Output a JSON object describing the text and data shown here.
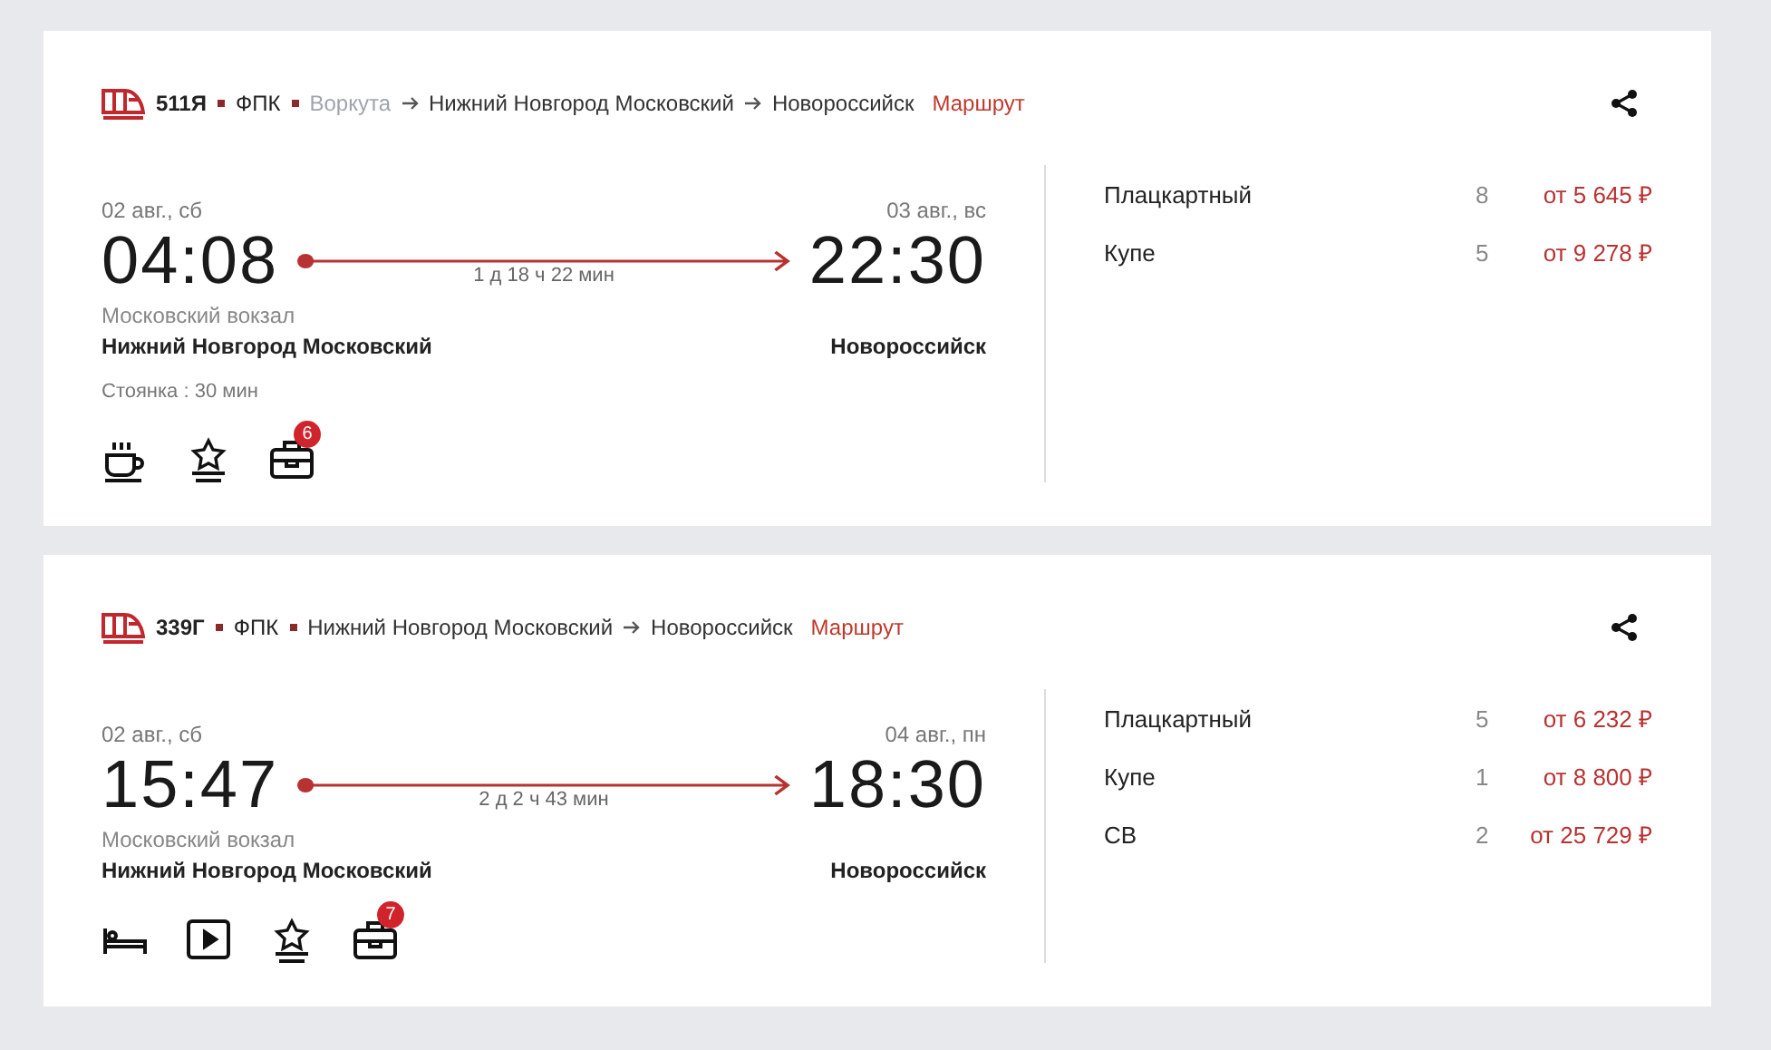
{
  "trains": [
    {
      "number": "511Я",
      "carrier": "ФПК",
      "route": [
        {
          "name": "Воркута",
          "dimmed": true
        },
        {
          "name": "Нижний Новгород Московский",
          "dimmed": false
        },
        {
          "name": "Новороссийск",
          "dimmed": false
        }
      ],
      "route_link": "Маршрут",
      "depart": {
        "date": "02 авг., сб",
        "time": "04:08",
        "station": "Московский вокзал",
        "city": "Нижний Новгород Московский"
      },
      "duration": "1 д 18 ч 22 мин",
      "arrive": {
        "date": "03 авг., вс",
        "time": "22:30",
        "city": "Новороссийск"
      },
      "stop": "Стоянка : 30 мин",
      "amenities": [
        {
          "kind": "cup"
        },
        {
          "kind": "star"
        },
        {
          "kind": "bag",
          "badge": "6"
        }
      ],
      "classes": [
        {
          "name": "Плацкартный",
          "seats": "8",
          "price": "от 5 645 ₽"
        },
        {
          "name": "Купе",
          "seats": "5",
          "price": "от 9 278 ₽"
        }
      ]
    },
    {
      "number": "339Г",
      "carrier": "ФПК",
      "route": [
        {
          "name": "Нижний Новгород Московский",
          "dimmed": false
        },
        {
          "name": "Новороссийск",
          "dimmed": false
        }
      ],
      "route_link": "Маршрут",
      "depart": {
        "date": "02 авг., сб",
        "time": "15:47",
        "station": "Московский вокзал",
        "city": "Нижний Новгород Московский"
      },
      "duration": "2 д 2 ч 43 мин",
      "arrive": {
        "date": "04 авг., пн",
        "time": "18:30",
        "city": "Новороссийск"
      },
      "amenities": [
        {
          "kind": "bed"
        },
        {
          "kind": "video"
        },
        {
          "kind": "star"
        },
        {
          "kind": "bag",
          "badge": "7"
        }
      ],
      "classes": [
        {
          "name": "Плацкартный",
          "seats": "5",
          "price": "от 6 232 ₽"
        },
        {
          "name": "Купе",
          "seats": "1",
          "price": "от 8 800 ₽"
        },
        {
          "name": "СВ",
          "seats": "2",
          "price": "от 25 729 ₽"
        }
      ]
    }
  ]
}
